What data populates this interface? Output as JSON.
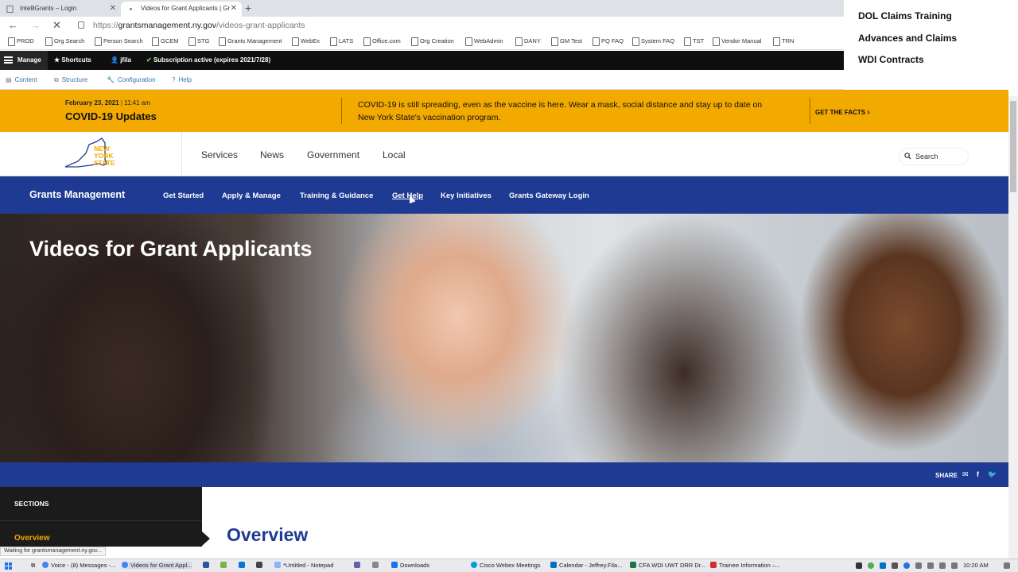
{
  "browser": {
    "tabs": [
      {
        "title": "IntelliGrants – Login",
        "active": false
      },
      {
        "title": "Videos for Grant Applicants | Gr",
        "active": true
      }
    ],
    "url_prefix": "https://",
    "url_host": "grantsmanagement.ny.gov",
    "url_path": "/videos-grant-applicants",
    "bookmarks": [
      "PROD",
      "Org Search",
      "Person Search",
      "GCEM",
      "STG",
      "Grants Management",
      "WebEx",
      "LATS",
      "Office.com",
      "Org Creation",
      "WebAdmin",
      "DANY",
      "GM Test",
      "PQ FAQ",
      "System FAQ",
      "TST",
      "Vendor Manual",
      "TRN"
    ],
    "status_text": "Waiting for grantsmanagement.ny.gov..."
  },
  "admin_toolbar": {
    "manage": "Manage",
    "shortcuts": "Shortcuts",
    "user": "jfila",
    "subscription": "Subscription active (expires 2021/7/28)",
    "content": "Content",
    "structure": "Structure",
    "configuration": "Configuration",
    "help": "Help"
  },
  "side_panel": {
    "items": [
      "DOL Claims Training",
      "Advances and Claims",
      "WDI Contracts"
    ]
  },
  "covid_banner": {
    "date": "February 23, 2021",
    "time": "11:41 am",
    "title": "COVID-19 Updates",
    "message": "COVID-19 is still spreading, even as the vaccine is here. Wear a mask, social distance and stay up to date on New York State's vaccination program.",
    "cta": "GET THE FACTS",
    "color": "#f2a900"
  },
  "site_header": {
    "logo_text_1": "NEW",
    "logo_text_2": "YORK",
    "logo_text_3": "STATE",
    "nav": [
      "Services",
      "News",
      "Government",
      "Local"
    ],
    "search_label": "Search"
  },
  "grants_nav": {
    "brand": "Grants Management",
    "items": [
      "Get Started",
      "Apply & Manage",
      "Training & Guidance",
      "Get Help",
      "Key Initiatives",
      "Grants Gateway Login"
    ],
    "color": "#1f3a93"
  },
  "hero": {
    "title": "Videos for Grant Applicants"
  },
  "share": {
    "label": "SHARE"
  },
  "sections": {
    "title": "SECTIONS",
    "items": [
      "Overview"
    ]
  },
  "content": {
    "heading": "Overview"
  },
  "taskbar": {
    "items": [
      "Voice - (8) Messages -...",
      "Videos for Grant Appl...",
      "*Untitled - Notepad",
      "Downloads",
      "Cisco Webex Meetings",
      "Calendar - Jeffrey.Fila...",
      "CFA WDI UWT DRR Dr...",
      "Trainee Information –..."
    ],
    "time": "10:20 AM"
  }
}
